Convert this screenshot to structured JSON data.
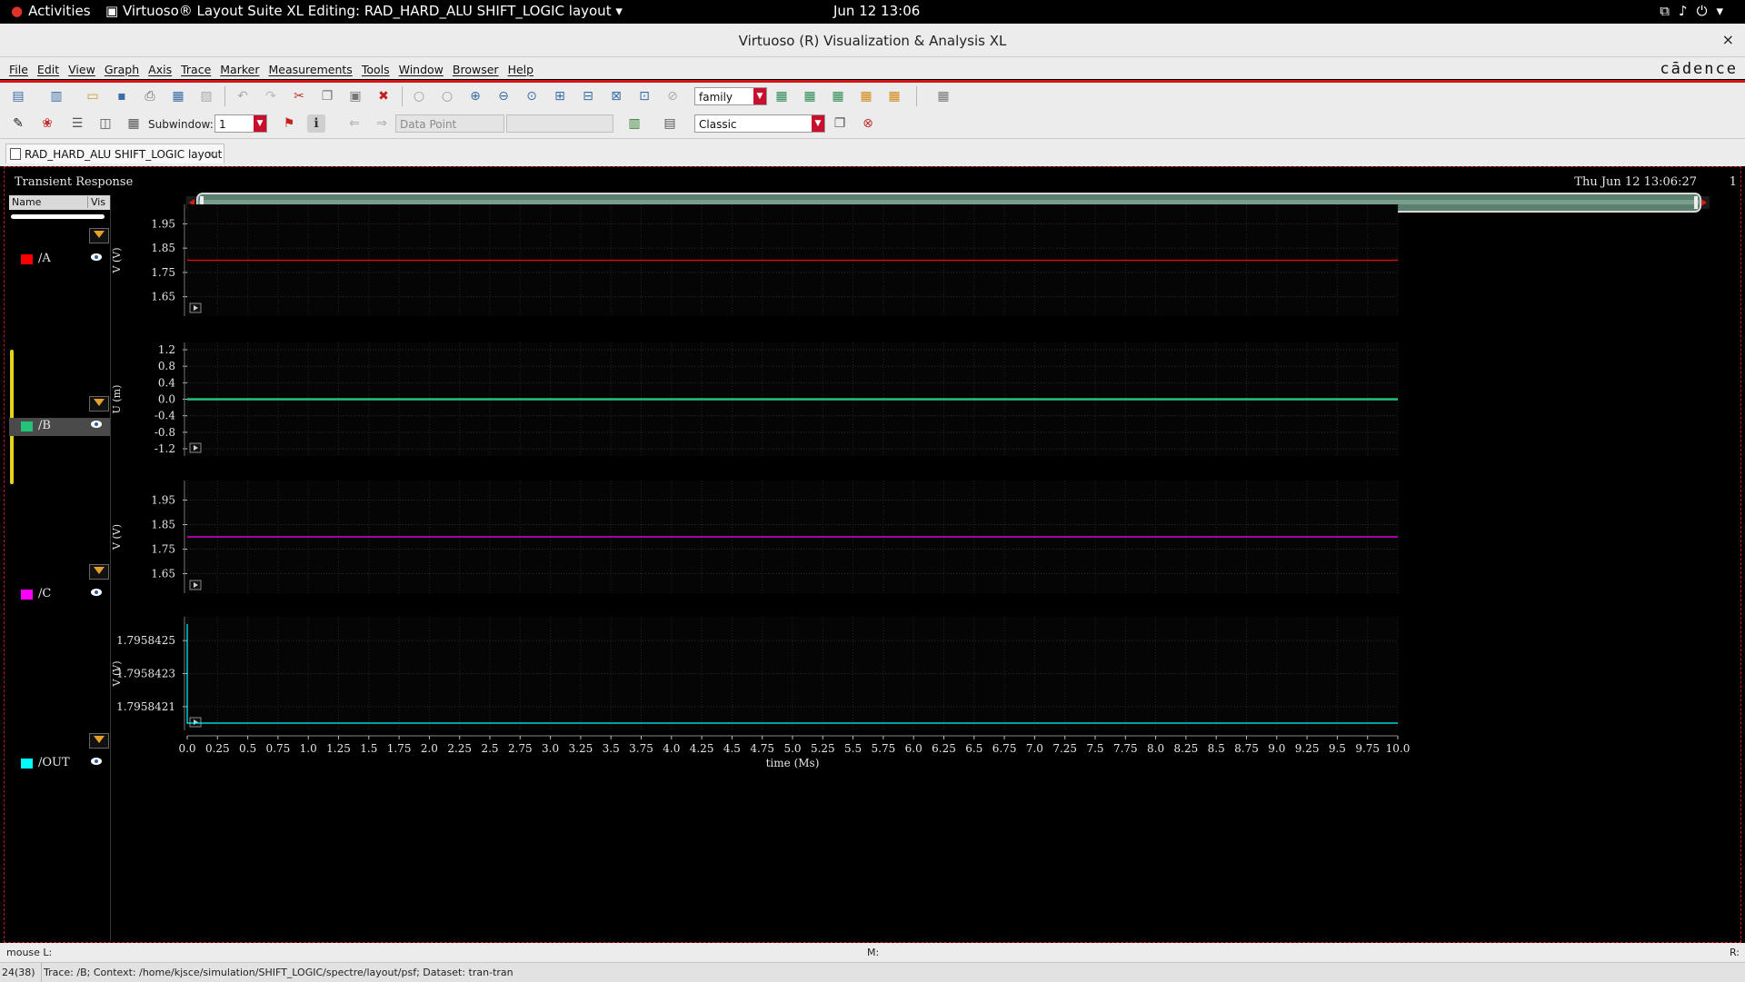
{
  "topbar": {
    "activities": "Activities",
    "app_title": "Virtuoso® Layout Suite XL Editing: RAD_HARD_ALU SHIFT_LOGIC layout",
    "clock": "Jun 12  13:06"
  },
  "window": {
    "title": "Virtuoso (R) Visualization & Analysis XL",
    "close": "×"
  },
  "menu": {
    "items": [
      "File",
      "Edit",
      "View",
      "Graph",
      "Axis",
      "Trace",
      "Marker",
      "Measurements",
      "Tools",
      "Window",
      "Browser",
      "Help"
    ],
    "brand": "cādence"
  },
  "toolbar": {
    "family_value": "family",
    "subwindow_label": "Subwindow:",
    "subwindow_value": "1",
    "datapoint_value": "Data Point",
    "style_value": "Classic"
  },
  "tab": {
    "label": "RAD_HARD_ALU SHIFT_LOGIC layout",
    "close": "×"
  },
  "graph": {
    "title": "Transient Response",
    "datetime": "Thu Jun 12 13:06:27",
    "subwindow_number": "1"
  },
  "legend": {
    "name_header": "Name",
    "vis_header": "Vis",
    "items": [
      {
        "name": "/A",
        "color": "#ff0000",
        "selected": false
      },
      {
        "name": "/B",
        "color": "#22c47a",
        "selected": true
      },
      {
        "name": "/C",
        "color": "#ff00ff",
        "selected": false
      },
      {
        "name": "/OUT",
        "color": "#00ffff",
        "selected": false
      }
    ]
  },
  "status": {
    "mouse_l": "mouse L:",
    "mouse_m": "M:",
    "mouse_r": "R:",
    "count": "24(38)",
    "message": "Trace: /B; Context: /home/kjsce/simulation/SHIFT_LOGIC/spectre/layout/psf; Dataset: tran-tran"
  },
  "chart_data": {
    "type": "line",
    "title": "Transient Response",
    "xlabel": "time (Ms)",
    "xlim": [
      0,
      10
    ],
    "x_ticks": [
      "0.0",
      "0.25",
      "0.5",
      "0.75",
      "1.0",
      "1.25",
      "1.5",
      "1.75",
      "2.0",
      "2.25",
      "2.5",
      "2.75",
      "3.0",
      "3.25",
      "3.5",
      "3.75",
      "4.0",
      "4.25",
      "4.5",
      "4.75",
      "5.0",
      "5.25",
      "5.5",
      "5.75",
      "6.0",
      "6.25",
      "6.5",
      "6.75",
      "7.0",
      "7.25",
      "7.5",
      "7.75",
      "8.0",
      "8.25",
      "8.5",
      "8.75",
      "9.0",
      "9.25",
      "9.5",
      "9.75",
      "10.0"
    ],
    "grid": true,
    "strips": [
      {
        "series": "/A",
        "color": "#ff0000",
        "ylabel": "V (V)",
        "ylim": [
          1.6,
          2.0
        ],
        "y_ticks": [
          "1.95",
          "1.85",
          "1.75",
          "1.65"
        ],
        "y_tick_values": [
          1.95,
          1.85,
          1.75,
          1.65
        ],
        "x": [
          0,
          10
        ],
        "y": [
          1.8,
          1.8
        ]
      },
      {
        "series": "/B",
        "color": "#22c47a",
        "ylabel": "U (m)",
        "ylim": [
          -1.2,
          1.2
        ],
        "y_ticks": [
          "1.2",
          "0.8",
          "0.4",
          "0.0",
          "-0.4",
          "-0.8",
          "-1.2"
        ],
        "y_tick_values": [
          1.2,
          0.8,
          0.4,
          0,
          -0.4,
          -0.8,
          -1.2
        ],
        "x": [
          0,
          10
        ],
        "y": [
          0,
          0
        ]
      },
      {
        "series": "/C",
        "color": "#ff00ff",
        "ylabel": "V (V)",
        "ylim": [
          1.6,
          2.0
        ],
        "y_ticks": [
          "1.95",
          "1.85",
          "1.75",
          "1.65"
        ],
        "y_tick_values": [
          1.95,
          1.85,
          1.75,
          1.65
        ],
        "x": [
          0,
          10
        ],
        "y": [
          1.8,
          1.8
        ]
      },
      {
        "series": "/OUT",
        "color": "#00ffff",
        "ylabel": "V (V)",
        "ylim": [
          1.795842,
          1.7958426
        ],
        "y_ticks": [
          "1.7958425",
          "1.7958423",
          "1.7958421"
        ],
        "y_tick_values": [
          1.7958425,
          1.7958423,
          1.7958421
        ],
        "x": [
          0,
          0.0001,
          0.0002,
          0.003,
          10
        ],
        "y": [
          1.7958426,
          1.7958422,
          1.795842,
          1.795842,
          1.795842
        ]
      }
    ]
  }
}
